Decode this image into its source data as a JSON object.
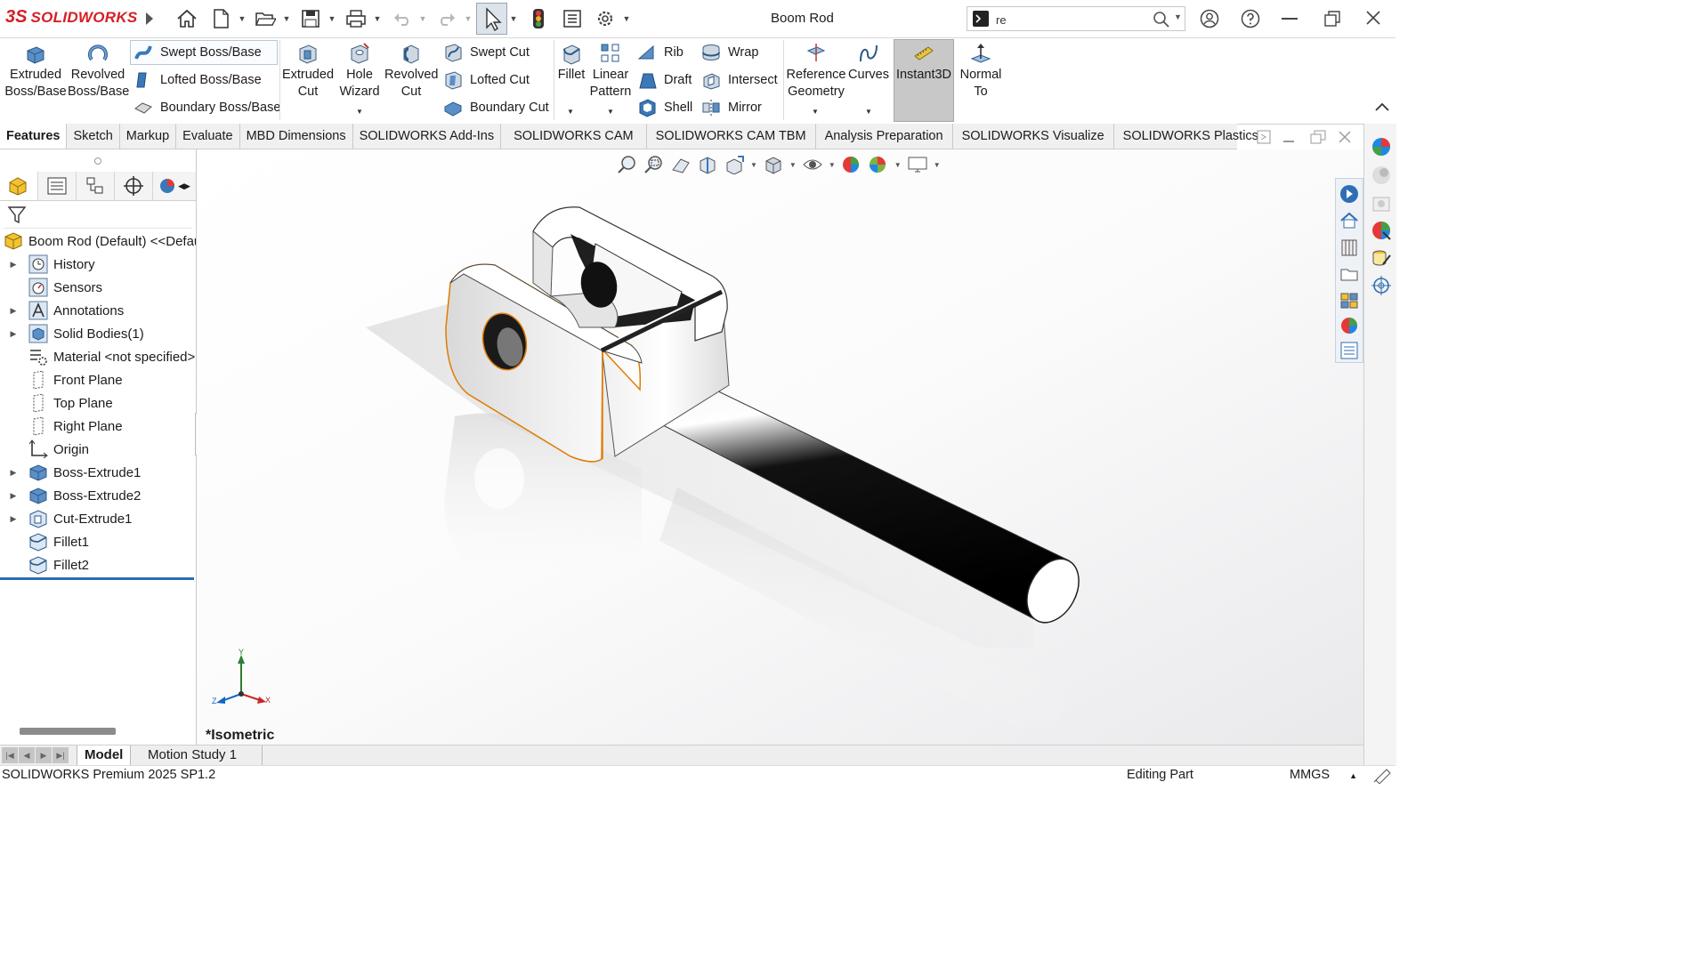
{
  "app": {
    "brand_prefix": "3S",
    "brand_name": "SOLIDWORKS",
    "document_title": "Boom Rod"
  },
  "search": {
    "value": "re",
    "placeholder": ""
  },
  "ribbon": {
    "extruded_boss": "Extruded Boss/Base",
    "revolved_boss": "Revolved Boss/Base",
    "swept_boss": "Swept Boss/Base",
    "lofted_boss": "Lofted Boss/Base",
    "boundary_boss": "Boundary Boss/Base",
    "extruded_cut": "Extruded Cut",
    "hole_wizard": "Hole Wizard",
    "revolved_cut": "Revolved Cut",
    "swept_cut": "Swept Cut",
    "lofted_cut": "Lofted Cut",
    "boundary_cut": "Boundary Cut",
    "fillet": "Fillet",
    "linear_pattern": "Linear Pattern",
    "rib": "Rib",
    "draft": "Draft",
    "shell": "Shell",
    "wrap": "Wrap",
    "intersect": "Intersect",
    "mirror": "Mirror",
    "reference_geometry": "Reference Geometry",
    "curves": "Curves",
    "instant3d": "Instant3D",
    "normal_to": "Normal To"
  },
  "tabs": [
    "Features",
    "Sketch",
    "Markup",
    "Evaluate",
    "MBD Dimensions",
    "SOLIDWORKS Add-Ins",
    "SOLIDWORKS CAM",
    "SOLIDWORKS CAM TBM",
    "Analysis Preparation",
    "SOLIDWORKS Visualize",
    "SOLIDWORKS Plastics"
  ],
  "tree": {
    "root": "Boom Rod (Default) <<Default>",
    "items": [
      {
        "label": "History"
      },
      {
        "label": "Sensors"
      },
      {
        "label": "Annotations"
      },
      {
        "label": "Solid Bodies(1)"
      },
      {
        "label": "Material <not specified>"
      },
      {
        "label": "Front Plane"
      },
      {
        "label": "Top Plane"
      },
      {
        "label": "Right Plane"
      },
      {
        "label": "Origin"
      },
      {
        "label": "Boss-Extrude1"
      },
      {
        "label": "Boss-Extrude2"
      },
      {
        "label": "Cut-Extrude1"
      },
      {
        "label": "Fillet1"
      },
      {
        "label": "Fillet2"
      }
    ]
  },
  "viewport": {
    "view_name": "*Isometric",
    "triad": {
      "x": "X",
      "y": "Y",
      "z": "Z"
    }
  },
  "bottom_tabs": {
    "model": "Model",
    "motion_study": "Motion Study 1"
  },
  "status": {
    "product": "SOLIDWORKS Premium 2025 SP1.2",
    "mode": "Editing Part",
    "units": "MMGS"
  },
  "colors": {
    "brand_red": "#d32027",
    "selection_edge": "#e07b00",
    "active_blue": "#2a6fb3"
  }
}
